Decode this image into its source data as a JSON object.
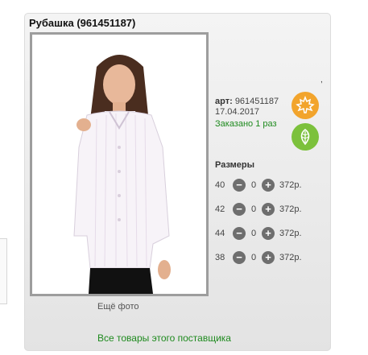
{
  "product": {
    "title": "Рубашка (961451187)",
    "art_label": "арт:",
    "art_number": "961451187",
    "date": "17.04.2017",
    "ordered_text": "Заказано 1 раз",
    "more_photo": "Ещё фото",
    "dot": ","
  },
  "sizes": {
    "title": "Размеры",
    "rows": [
      {
        "size": "40",
        "qty": "0",
        "price": "372р."
      },
      {
        "size": "42",
        "qty": "0",
        "price": "372р."
      },
      {
        "size": "44",
        "qty": "0",
        "price": "372р."
      },
      {
        "size": "38",
        "qty": "0",
        "price": "372р."
      }
    ],
    "minus": "−",
    "plus": "+"
  },
  "supplier_link": "Все товары этого поставщика",
  "icons": {
    "badge_top": "maple-leaf-icon",
    "badge_bottom": "leaf-icon"
  },
  "colors": {
    "maple_badge": "#f2a42c",
    "leaf_badge": "#7cc13c",
    "link_green": "#1e8a1e"
  }
}
